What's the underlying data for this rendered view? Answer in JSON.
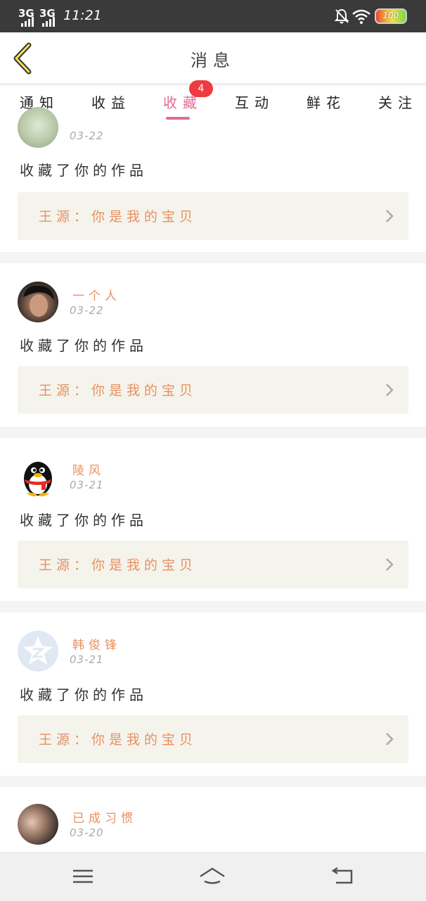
{
  "status_bar": {
    "signal_1": "3G",
    "signal_2": "3G",
    "time": "11:21",
    "battery": "100"
  },
  "header": {
    "title": "消息",
    "back_icon": "chevron-left-icon"
  },
  "tabs": [
    {
      "label": "通知",
      "active": false
    },
    {
      "label": "收益",
      "active": false
    },
    {
      "label": "收藏",
      "active": true,
      "badge": "4"
    },
    {
      "label": "互动",
      "active": false
    },
    {
      "label": "鲜花",
      "active": false
    },
    {
      "label": "关注",
      "active": false
    }
  ],
  "accent_color": "#e06b97",
  "name_color": "#ea8f61",
  "messages": [
    {
      "user": "",
      "date": "03-22",
      "action": "收藏了你的作品",
      "source": "王源：你是我的宝贝"
    },
    {
      "user": "一个人",
      "date": "03-22",
      "action": "收藏了你的作品",
      "source": "王源：你是我的宝贝"
    },
    {
      "user": "陵风",
      "date": "03-21",
      "action": "收藏了你的作品",
      "source": "王源：你是我的宝贝"
    },
    {
      "user": "韩俊锋",
      "date": "03-21",
      "action": "收藏了你的作品",
      "source": "王源：你是我的宝贝"
    },
    {
      "user": "已成习惯",
      "date": "03-20",
      "action": "",
      "source": ""
    }
  ],
  "nav": [
    "menu-icon",
    "home-icon",
    "back-icon"
  ]
}
